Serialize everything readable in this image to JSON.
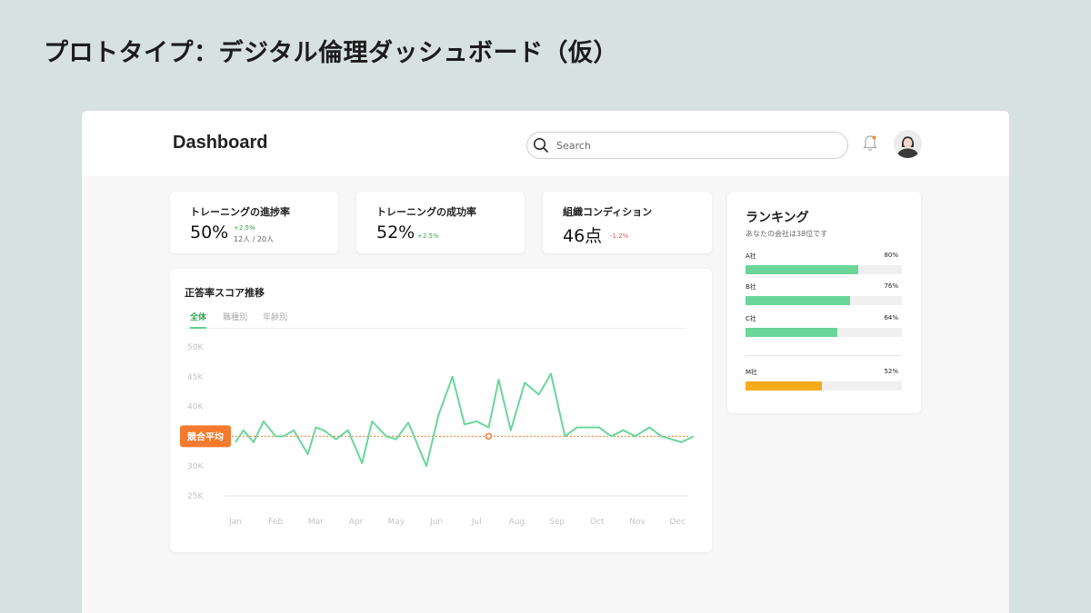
{
  "page": {
    "heading": "プロトタイプ：デジタル倫理ダッシュボード（仮）"
  },
  "header": {
    "brand": "Dashboard",
    "search": {
      "placeholder": "Search",
      "value": ""
    },
    "icons": {
      "search": "search-icon",
      "notification": "bell-icon",
      "avatar": "user-avatar"
    },
    "notification_dot_color": "#f28a2e"
  },
  "kpis": [
    {
      "title": "トレーニングの進捗率",
      "value": "50%",
      "delta": "+2.5%",
      "sub": "12人 / 20人",
      "trend": "up"
    },
    {
      "title": "トレーニングの成功率",
      "value": "52%",
      "delta": "+2.5%",
      "trend": "up"
    },
    {
      "title": "組織コンディション",
      "value": "46点",
      "delta": "-1.2%",
      "trend": "down"
    }
  ],
  "chart": {
    "tabs": [
      {
        "label": "全体",
        "active": true
      },
      {
        "label": "職種別",
        "active": false
      },
      {
        "label": "年齢別",
        "active": false
      }
    ]
  },
  "chart_data": {
    "type": "line",
    "title": "正答率スコア推移",
    "x_tick_labels": [
      "Jan",
      "Feb",
      "Mar",
      "Apr",
      "May",
      "Jun",
      "Jul",
      "Aug",
      "Sep",
      "Oct",
      "Nov",
      "Dec"
    ],
    "y_tick_labels": [
      "50K",
      "45K",
      "40K",
      "35K",
      "30K",
      "25K"
    ],
    "ylim": [
      25000,
      50000
    ],
    "series": [
      {
        "color": "#6ad69a",
        "x": [
          0,
          0.2,
          0.45,
          0.7,
          1,
          1.2,
          1.45,
          1.8,
          2,
          2.2,
          2.5,
          2.8,
          3.15,
          3.4,
          3.75,
          4,
          4.3,
          4.75,
          5.05,
          5.4,
          5.7,
          6,
          6.3,
          6.55,
          6.85,
          7.2,
          7.55,
          7.85,
          8.2,
          8.5,
          8.75,
          9.05,
          9.35,
          9.65,
          9.95,
          10.3,
          10.6,
          10.85,
          11.1,
          11.4
        ],
        "y": [
          34000,
          36000,
          34000,
          37500,
          35000,
          35000,
          36000,
          32000,
          36500,
          36000,
          34500,
          36000,
          30500,
          37500,
          35000,
          34500,
          37300,
          30000,
          38500,
          45000,
          37000,
          37500,
          36500,
          44500,
          36000,
          44000,
          42000,
          45500,
          35000,
          36500,
          36500,
          36500,
          35000,
          36000,
          35000,
          36500,
          35000,
          34500,
          34000,
          35000
        ]
      }
    ],
    "reference_line": {
      "label": "競合平均",
      "value": 35000,
      "color": "#f47a2d"
    },
    "highlight_point": {
      "x": 6.3,
      "y": 35000
    },
    "grid": false
  },
  "ranking": {
    "title": "ランキング",
    "subtitle": "あなたの会社は38位です",
    "items": [
      {
        "name": "A社",
        "pct_label": "80%",
        "fill": 0.72,
        "color": "#6ad69a"
      },
      {
        "name": "B社",
        "pct_label": "76%",
        "fill": 0.67,
        "color": "#6ad69a"
      },
      {
        "name": "C社",
        "pct_label": "64%",
        "fill": 0.59,
        "color": "#6ad69a"
      },
      {
        "name": "M社",
        "pct_label": "52%",
        "fill": 0.49,
        "color": "#f7aa1a"
      }
    ]
  }
}
